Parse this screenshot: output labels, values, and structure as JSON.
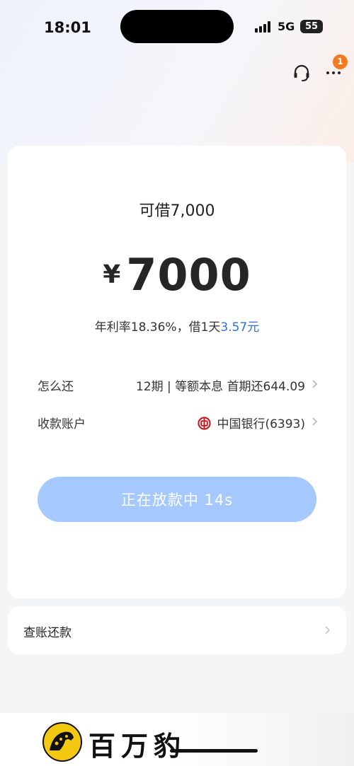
{
  "status_bar": {
    "time": "18:01",
    "network": "5G",
    "battery": "55"
  },
  "header": {
    "notification_count": "1",
    "icons": [
      "headset-icon",
      "more-icon"
    ]
  },
  "loan_card": {
    "quota_label": "可借7,000",
    "currency_symbol": "¥",
    "amount": "7000",
    "rate_text": "年利率18.36%，借1天",
    "rate_daily": "3.57元",
    "repayment": {
      "label": "怎么还",
      "value": "12期 | 等额本息  首期还644.09"
    },
    "account": {
      "label": "收款账户",
      "value": "中国银行(6393)",
      "bank_icon": "bank-of-china-icon"
    },
    "button_label": "正在放款中 14s"
  },
  "bill_card": {
    "label": "查账还款"
  },
  "footer": {
    "brand": "百万豹",
    "logo_icon": "leopard-logo-icon"
  },
  "colors": {
    "accent": "#2e6fd8",
    "button_disabled": "#a5c9ff",
    "badge": "#f47a1f",
    "bank_red": "#c8171e",
    "logo_yellow": "#f2c811"
  }
}
